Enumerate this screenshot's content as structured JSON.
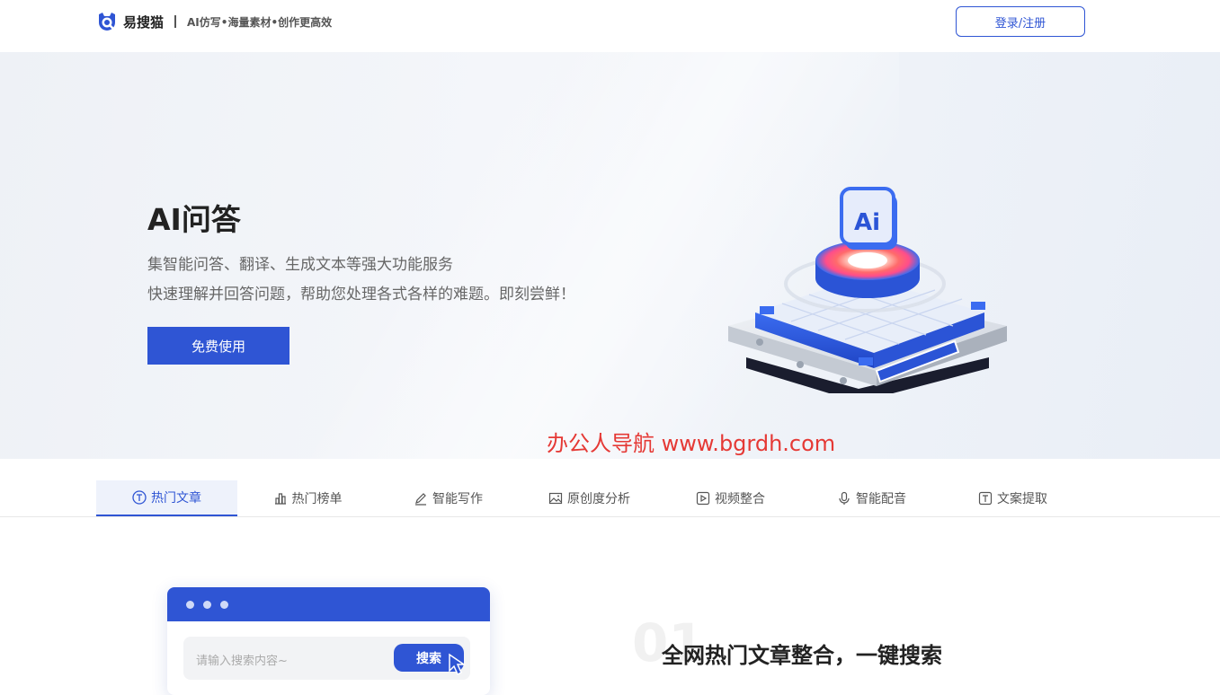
{
  "header": {
    "brand": "易搜猫",
    "slogan": "AI仿写•海量素材•创作更高效",
    "login_label": "登录/注册"
  },
  "hero": {
    "title": "AI问答",
    "desc_line1": "集智能问答、翻译、生成文本等强大功能服务",
    "desc_line2": "快速理解并回答问题，帮助您处理各式各样的难题。即刻尝鲜！",
    "cta_label": "免费使用",
    "illustration_badge": "Ai",
    "watermark": "办公人导航  www.bgrdh.com"
  },
  "tabs": [
    {
      "label": "热门文章",
      "icon": "article-icon",
      "active": true
    },
    {
      "label": "热门榜单",
      "icon": "bar-chart-icon",
      "active": false
    },
    {
      "label": "智能写作",
      "icon": "pen-icon",
      "active": false
    },
    {
      "label": "原创度分析",
      "icon": "image-icon",
      "active": false
    },
    {
      "label": "视频整合",
      "icon": "play-icon",
      "active": false
    },
    {
      "label": "智能配音",
      "icon": "microphone-icon",
      "active": false
    },
    {
      "label": "文案提取",
      "icon": "text-icon",
      "active": false
    }
  ],
  "feature": {
    "search_placeholder": "请输入搜索内容~",
    "search_button": "搜索",
    "number": "01",
    "title": "全网热门文章整合，一键搜索"
  },
  "colors": {
    "accent": "#2f55d4",
    "watermark": "#e53935"
  }
}
